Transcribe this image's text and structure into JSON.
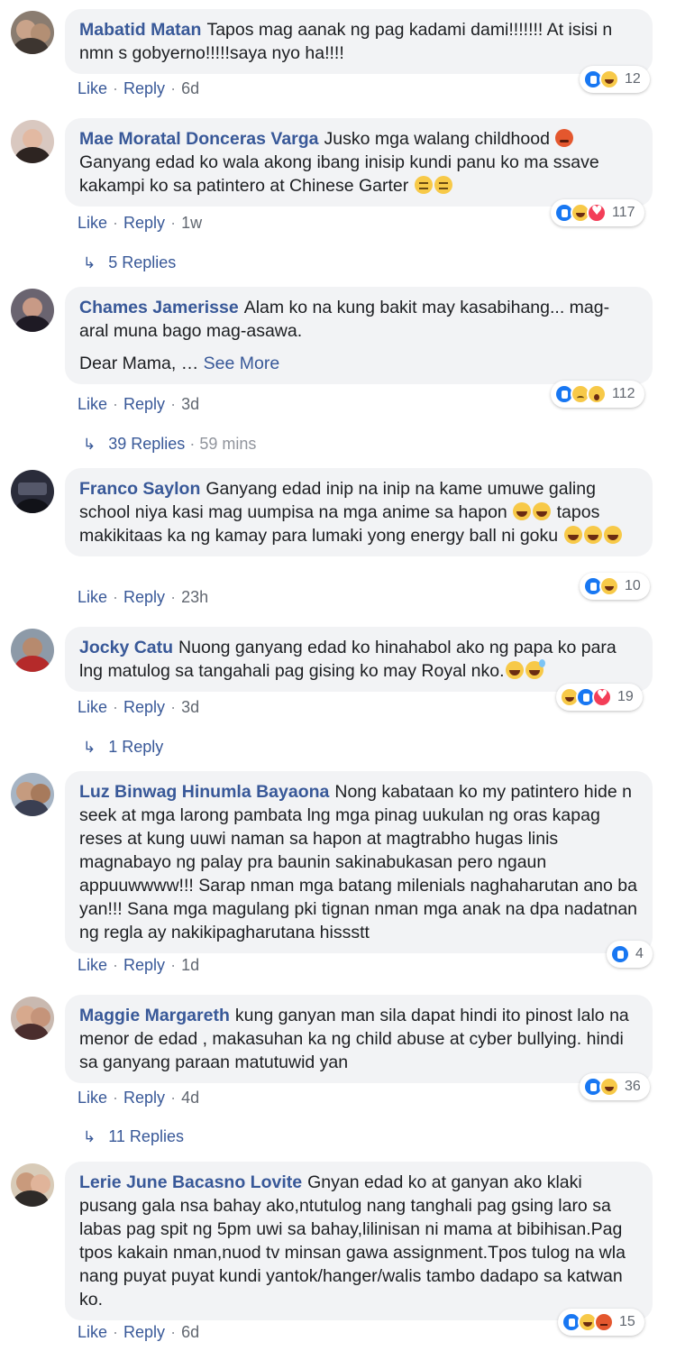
{
  "actions": {
    "like": "Like",
    "reply": "Reply",
    "dot": "·"
  },
  "reply_arrow": "↳",
  "comments": [
    {
      "author": "Mabatid Matan",
      "text": "Tapos mag aanak ng pag kadami dami!!!!!!! At isisi n nmn s gobyerno!!!!!saya nyo ha!!!!",
      "time": "6d",
      "reactions": [
        "like",
        "haha"
      ],
      "reaction_count": "12"
    },
    {
      "author": "Mae Moratal Donceras Varga",
      "text": "Jusko mga walang childhood",
      "text_b": "Ganyang edad ko wala akong ibang inisip kundi panu ko ma ssave kakampi ko sa patintero at Chinese Garter",
      "time": "1w",
      "reactions": [
        "like",
        "haha",
        "love"
      ],
      "reaction_count": "117",
      "replies": "5 Replies"
    },
    {
      "author": "Chames Jamerisse",
      "text": "Alam ko na kung bakit may kasabihang... mag-aral muna bago mag-asawa.",
      "text_b": "Dear Mama, …",
      "see_more": "See More",
      "time": "3d",
      "reactions": [
        "like",
        "sad",
        "wow"
      ],
      "reaction_count": "112",
      "replies": "39 Replies",
      "replies_time": "59 mins"
    },
    {
      "author": "Franco Saylon",
      "text": "Ganyang edad inip na inip na kame umuwe galing school niya kasi mag uumpisa na mga anime sa hapon",
      "text_b": "tapos makikitaas ka ng kamay para lumaki yong energy ball ni goku",
      "time": "23h",
      "reactions": [
        "like",
        "haha"
      ],
      "reaction_count": "10"
    },
    {
      "author": "Jocky Catu",
      "text": "Nuong ganyang edad ko hinahabol ako ng papa ko para lng matulog sa tangahali pag gising ko may Royal nko.",
      "time": "3d",
      "reactions": [
        "haha",
        "like",
        "love"
      ],
      "reaction_count": "19",
      "replies": "1 Reply"
    },
    {
      "author": "Luz Binwag Hinumla Bayaona",
      "text": "Nong kabataan ko my patintero hide n seek at mga larong pambata lng mga pinag uukulan ng oras kapag reses at kung uuwi naman sa hapon at magtrabho hugas linis magnabayo ng palay pra baunin sakinabukasan pero ngaun appuuwwww!!! Sarap nman mga batang milenials naghaharutan ano ba yan!!! Sana mga magulang pki tignan nman mga anak na dpa nadatnan ng regla ay nakikipagharutana hissstt",
      "time": "1d",
      "reactions": [
        "like"
      ],
      "reaction_count": "4"
    },
    {
      "author": "Maggie Margareth",
      "text": "kung ganyan man sila dapat hindi ito pinost lalo na menor de edad , makasuhan ka ng child abuse at cyber bullying. hindi sa ganyang paraan matutuwid yan",
      "time": "4d",
      "reactions": [
        "like",
        "haha"
      ],
      "reaction_count": "36",
      "replies": "11 Replies"
    },
    {
      "author": "Lerie June Bacasno Lovite",
      "text": "Gnyan edad ko at ganyan ako klaki pusang gala nsa bahay ako,ntutulog nang tanghali pag gsing laro sa labas pag spit ng 5pm uwi sa bahay,lilinisan ni mama at bibihisan.Pag tpos kakain nman,nuod tv minsan gawa assignment.Tpos tulog na wla nang puyat puyat kundi yantok/hanger/walis tambo dadapo sa katwan ko.",
      "time": "6d",
      "reactions": [
        "like",
        "haha",
        "angry"
      ],
      "reaction_count": "15"
    }
  ]
}
